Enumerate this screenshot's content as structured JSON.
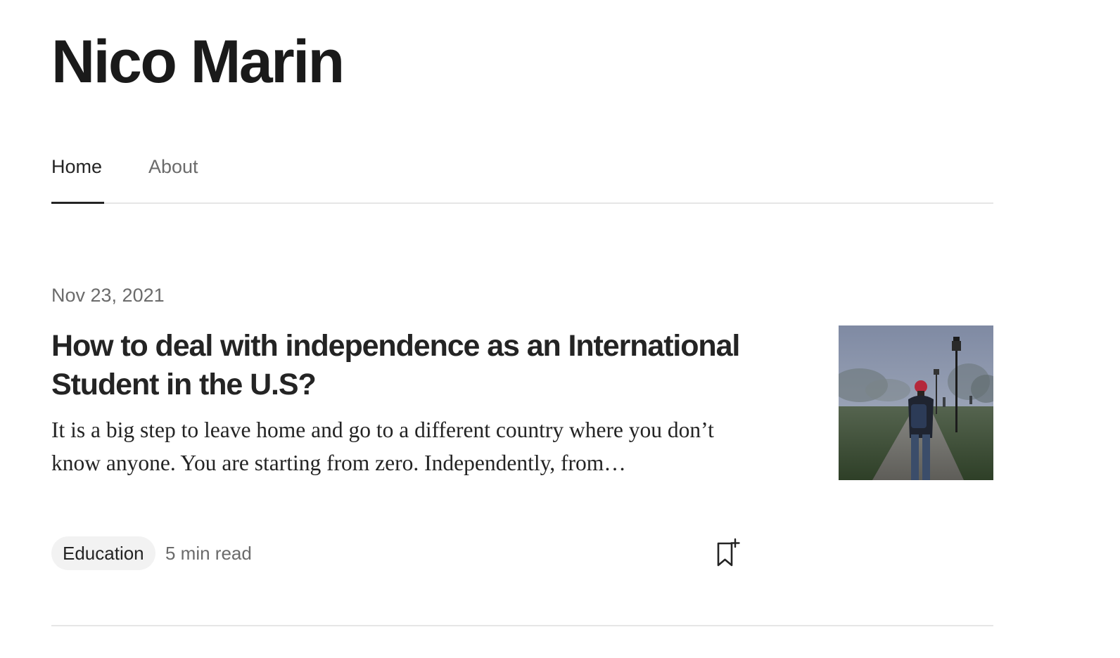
{
  "author": {
    "name": "Nico Marin"
  },
  "tabs": [
    {
      "label": "Home",
      "active": true
    },
    {
      "label": "About",
      "active": false
    }
  ],
  "post": {
    "date": "Nov 23, 2021",
    "title": "How to deal with independence as an International Student in the U.S?",
    "excerpt": "It is a big step to leave home and go to a different country where you don’t know anyone. You are starting from zero. Independently, from…",
    "tag": "Education",
    "read_time": "5 min read",
    "thumbnail": "student-walking-foggy-campus-path",
    "bookmark_icon": "bookmark-add-icon"
  },
  "colors": {
    "text_primary": "#242424",
    "text_secondary": "#6b6b6b",
    "divider": "#e6e6e6",
    "tag_background": "#f2f2f2"
  }
}
